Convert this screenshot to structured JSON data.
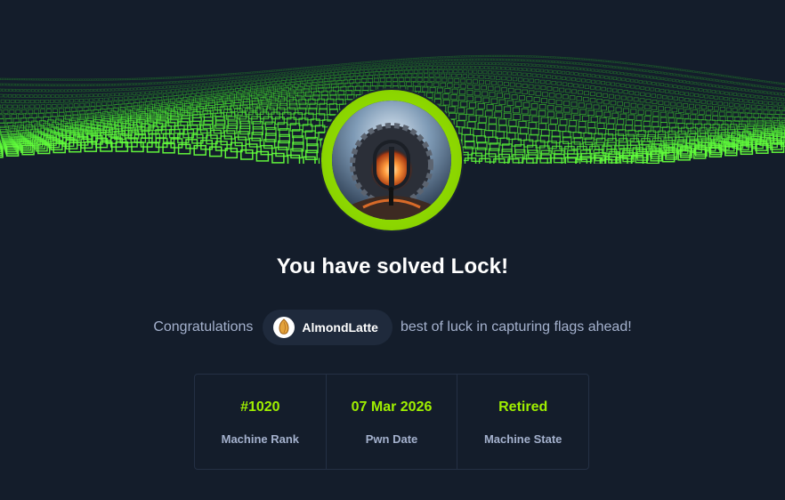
{
  "banner": {
    "image": "green-cube-wave-banner"
  },
  "machine": {
    "avatar": "machine-avatar-portal",
    "title": "You have solved Lock!"
  },
  "message": {
    "prefix": "Congratulations",
    "username": "AlmondLatte",
    "user_avatar": "almond-avatar",
    "suffix": "best of luck in capturing flags ahead!"
  },
  "stats": [
    {
      "value": "#1020",
      "label": "Machine Rank"
    },
    {
      "value": "07 Mar 2026",
      "label": "Pwn Date"
    },
    {
      "value": "Retired",
      "label": "Machine State"
    }
  ],
  "colors": {
    "background": "#141d2b",
    "accent": "#9fef00",
    "muted_text": "#a4b1cd",
    "chip_bg": "#1f2a3c"
  }
}
